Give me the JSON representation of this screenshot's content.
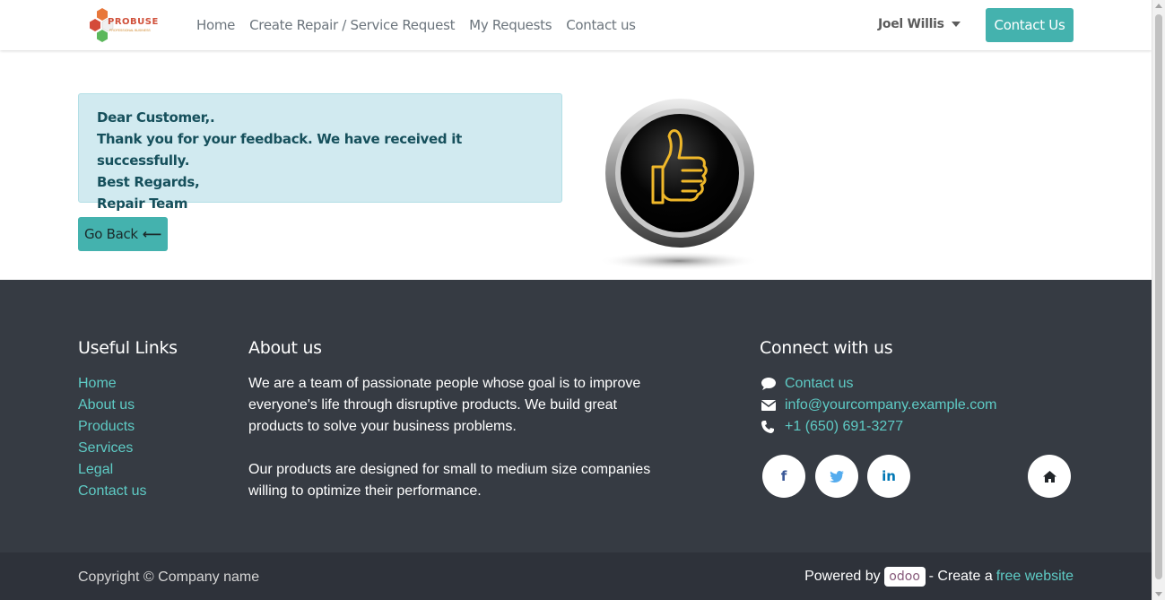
{
  "navbar": {
    "logo_text": "PROBUSE",
    "logo_subtext": "PROFESSIONAL BUSINESS",
    "links": [
      "Home",
      "Create Repair / Service Request",
      "My Requests",
      "Contact us"
    ],
    "user_name": "Joel Willis",
    "contact_button": "Contact Us"
  },
  "message": {
    "lines": [
      "Dear Customer,.",
      "Thank you for your feedback. We have received it successfully.",
      "Best Regards,",
      "Repair Team"
    ],
    "go_back_label": "Go Back",
    "go_back_icon": "⟵",
    "graphic_icon": "thumbs-up-icon"
  },
  "footer": {
    "useful_links_title": "Useful Links",
    "useful_links": [
      "Home",
      "About us",
      "Products",
      "Services",
      "Legal",
      "Contact us"
    ],
    "about_title": "About us",
    "about_paragraphs": [
      "We are a team of passionate people whose goal is to improve everyone's life through disruptive products. We build great products to solve your business problems.",
      "Our products are designed for small to medium size companies willing to optimize their performance."
    ],
    "connect_title": "Connect with us",
    "connect_items": [
      {
        "icon": "comment-icon",
        "text": "Contact us"
      },
      {
        "icon": "envelope-icon",
        "text": "info@yourcompany.example.com"
      },
      {
        "icon": "phone-icon",
        "text": "+1 (650) 691-3277"
      }
    ],
    "social": [
      {
        "icon": "facebook-icon",
        "glyph": "f",
        "color": "#3b5998"
      },
      {
        "icon": "twitter-icon",
        "glyph": "t",
        "color": "#55acee"
      },
      {
        "icon": "linkedin-icon",
        "glyph": "in",
        "color": "#0077b5"
      },
      {
        "icon": "home-icon",
        "glyph": "",
        "color": "#212529"
      }
    ]
  },
  "copyright": {
    "text": "Copyright © Company name",
    "powered_by": "Powered by",
    "odoo": "odoo",
    "create_text": "- Create a",
    "free_website": "free website"
  },
  "colors": {
    "accent": "#44b2ae",
    "link": "#5ecbc5",
    "footer_bg": "#363b43",
    "alert_bg": "#d1eaf0",
    "alert_text": "#16505c"
  }
}
